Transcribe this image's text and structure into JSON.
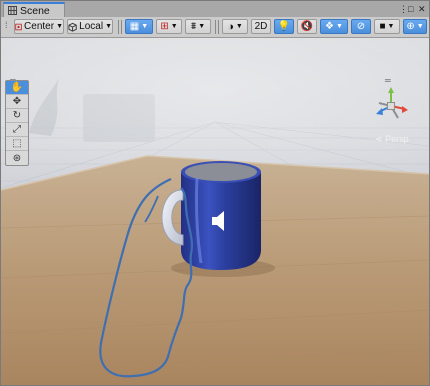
{
  "window": {
    "tab_title": "Scene",
    "menu_icon": "kebab-menu-icon",
    "maximize_icon": "maximize-icon",
    "close_icon": "close-icon"
  },
  "toolbar": {
    "pivot_mode": "Center",
    "pivot_rotation": "Local",
    "dimension_toggle": "2D",
    "icons": [
      "grid-snap-icon",
      "increment-snap-icon",
      "snap-settings-icon",
      "shading-mode-icon",
      "lighting-icon",
      "audio-icon",
      "effects-icon",
      "scene-visibility-icon",
      "camera-icon",
      "gizmos-icon"
    ]
  },
  "tools_panel": {
    "items": [
      "hand-tool-icon",
      "move-tool-icon",
      "rotate-tool-icon",
      "scale-tool-icon",
      "rect-tool-icon",
      "transform-tool-icon"
    ],
    "active_index": 0
  },
  "orientation_gizmo": {
    "projection_label": "Persp"
  },
  "colors": {
    "active_blue": "#4a8fdc",
    "mug_blue": "#2c3f9e",
    "hand_outline": "#3f6fb0",
    "floor_wood": "#b99a76"
  }
}
